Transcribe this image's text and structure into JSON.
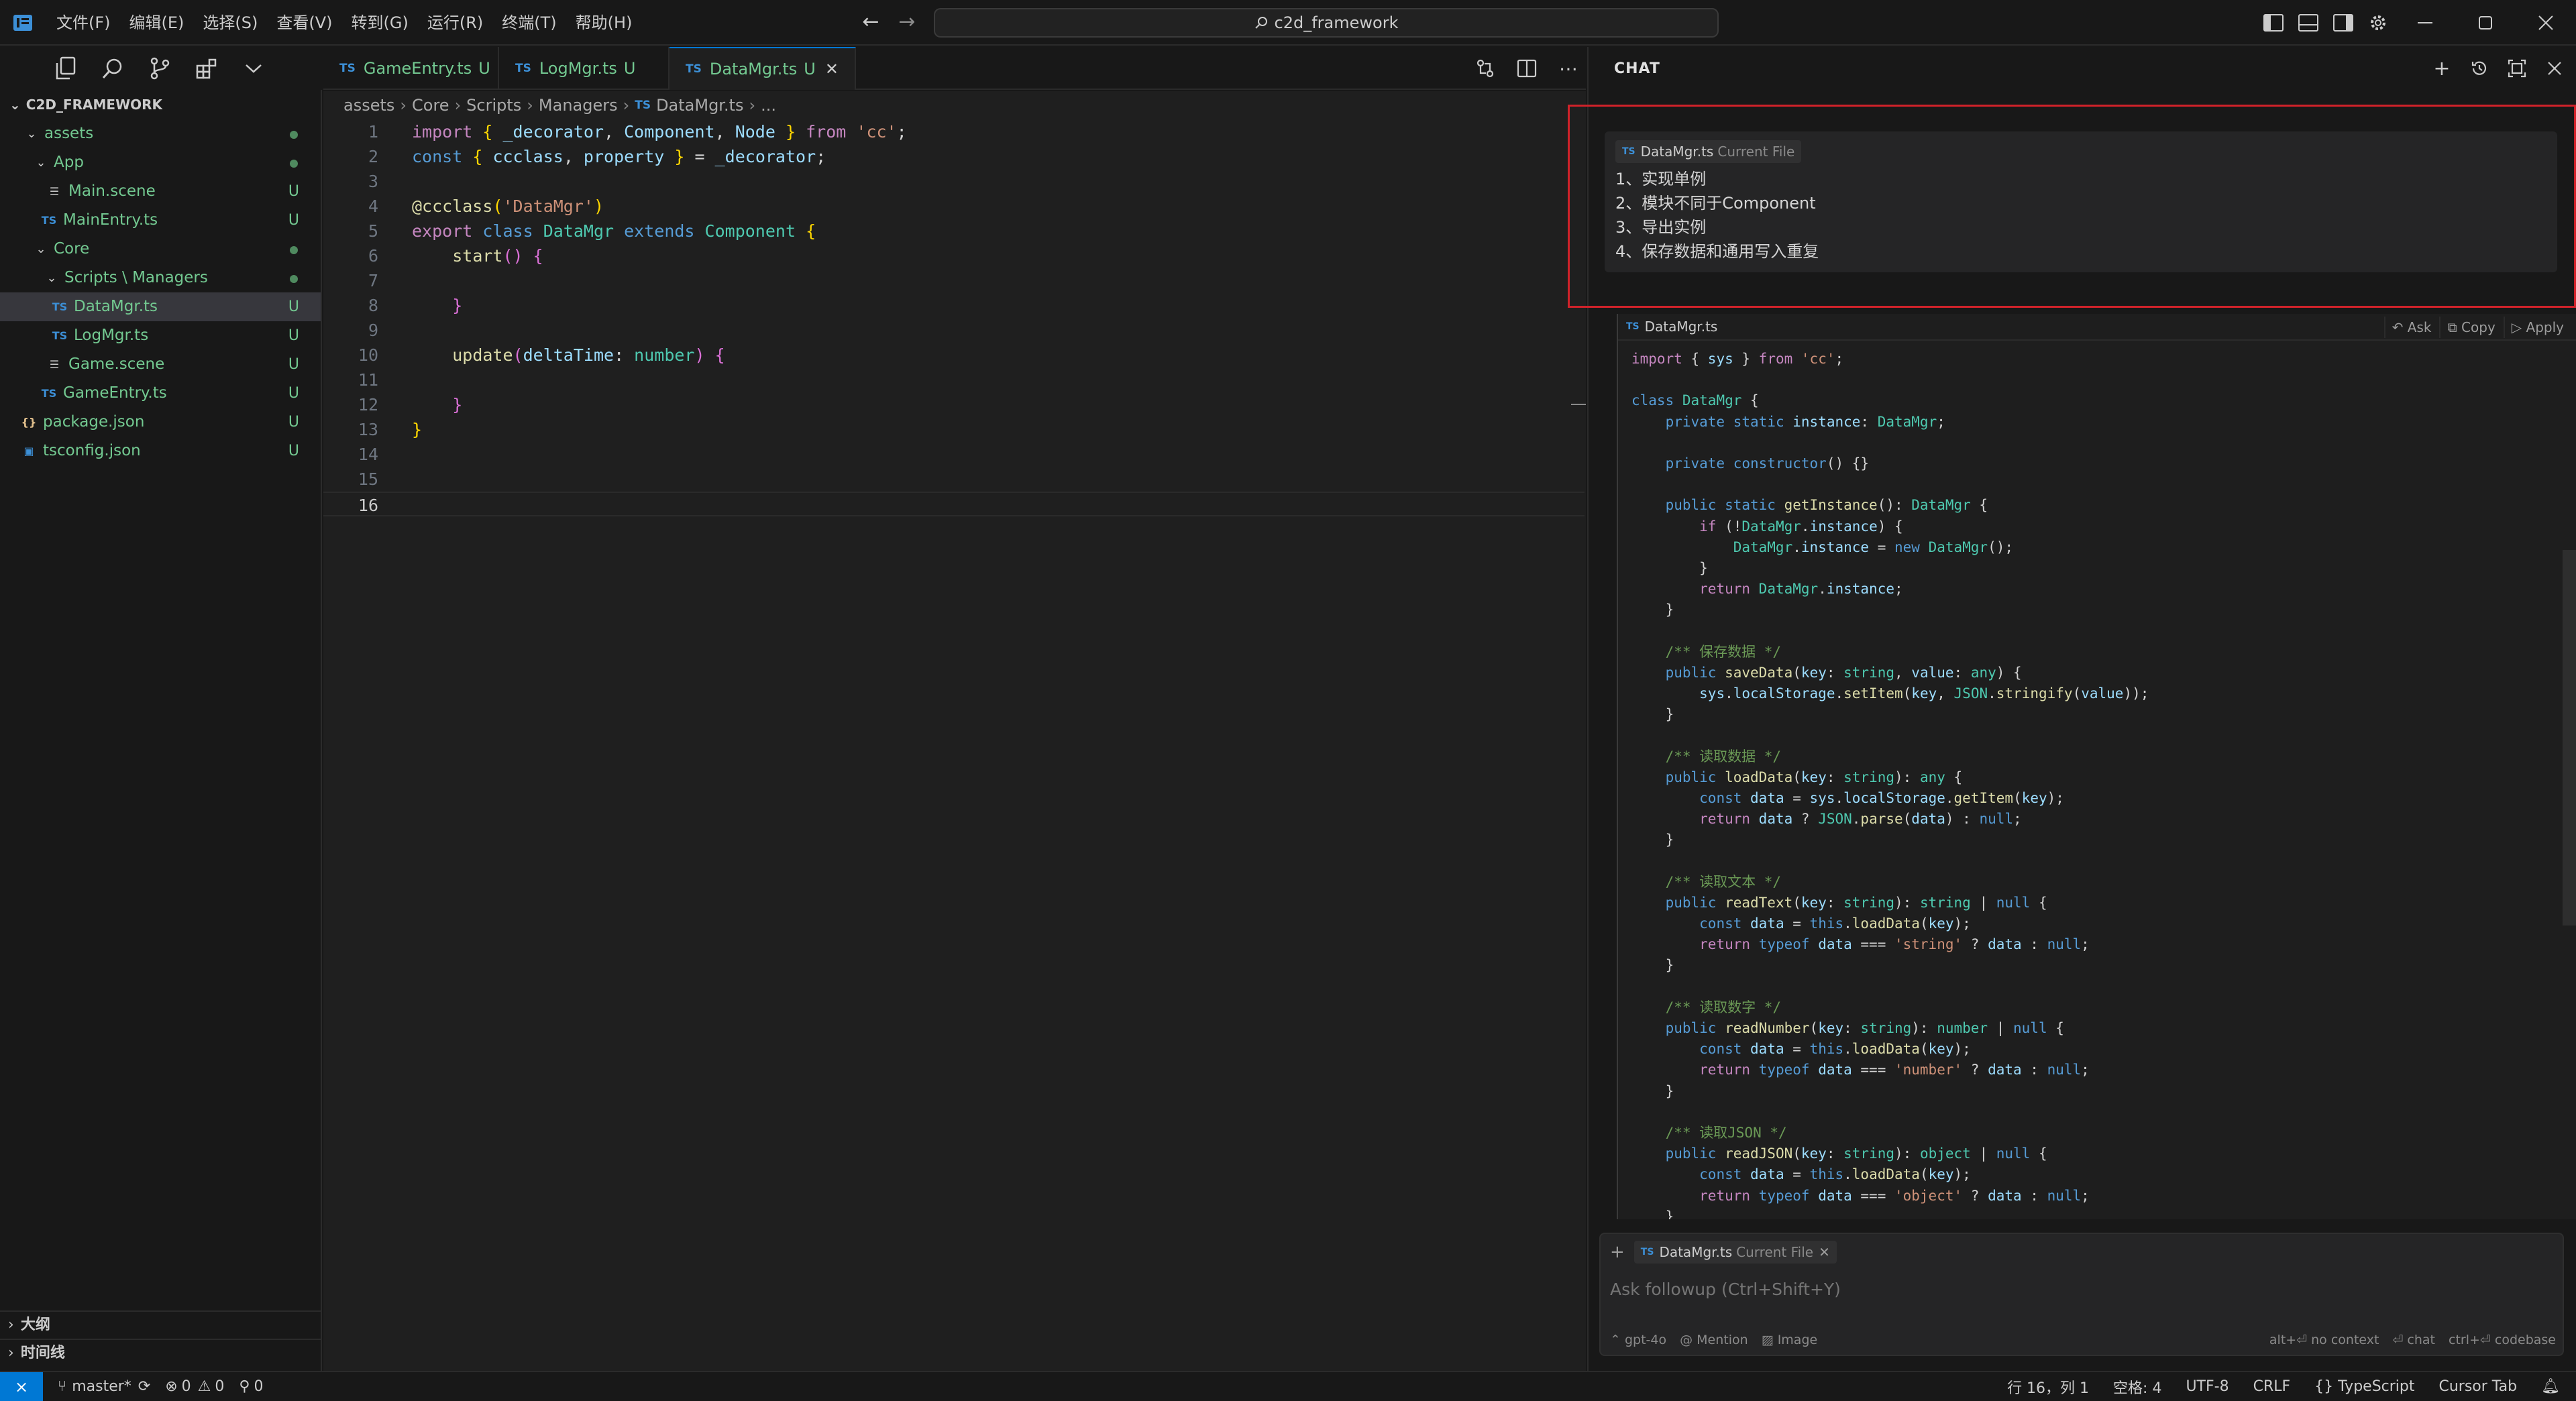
{
  "menubar": [
    "文件(F)",
    "编辑(E)",
    "选择(S)",
    "查看(V)",
    "转到(G)",
    "运行(R)",
    "终端(T)",
    "帮助(H)"
  ],
  "command_center": "c2d_framework",
  "explorer": {
    "root": "C2D_FRAMEWORK",
    "items": [
      {
        "label": "assets",
        "status": ""
      },
      {
        "label": "App",
        "status": ""
      },
      {
        "label": "Main.scene",
        "status": "U"
      },
      {
        "label": "MainEntry.ts",
        "status": "U"
      },
      {
        "label": "Core",
        "status": ""
      },
      {
        "label": "Scripts \\ Managers",
        "status": ""
      },
      {
        "label": "DataMgr.ts",
        "status": "U"
      },
      {
        "label": "LogMgr.ts",
        "status": "U"
      },
      {
        "label": "Game.scene",
        "status": "U"
      },
      {
        "label": "GameEntry.ts",
        "status": "U"
      },
      {
        "label": "package.json",
        "status": "U"
      },
      {
        "label": "tsconfig.json",
        "status": "U"
      }
    ],
    "outline": "大纲",
    "timeline": "时间线"
  },
  "tabs": [
    {
      "badge": "TS",
      "label": "GameEntry.ts",
      "status": "U"
    },
    {
      "badge": "TS",
      "label": "LogMgr.ts",
      "status": "U"
    },
    {
      "badge": "TS",
      "label": "DataMgr.ts",
      "status": "U"
    }
  ],
  "breadcrumb": [
    "assets",
    "Core",
    "Scripts",
    "Managers",
    "DataMgr.ts",
    "..."
  ],
  "editor_line_numbers": [
    "1",
    "2",
    "3",
    "4",
    "5",
    "6",
    "7",
    "8",
    "9",
    "10",
    "11",
    "12",
    "13",
    "14",
    "15",
    "16"
  ],
  "chat": {
    "title": "CHAT",
    "context_file": "DataMgr.ts",
    "context_note": "Current File",
    "user_message": [
      "1、实现单例",
      "2、模块不同于Component",
      "3、导出实例",
      "4、保存数据和通用写入重复"
    ],
    "code_block_file": "DataMgr.ts",
    "code_actions": [
      "Ask",
      "Copy",
      "Apply"
    ],
    "followup_placeholder": "Ask followup (Ctrl+Shift+Y)",
    "followup_chip_file": "DataMgr.ts",
    "followup_chip_note": "Current File",
    "model": "gpt-4o",
    "mention": "Mention",
    "image": "Image",
    "shortcuts": [
      "alt+⏎ no context",
      "⏎ chat",
      "ctrl+⏎ codebase"
    ]
  },
  "statusbar": {
    "branch": "master*",
    "errors": "0",
    "warnings": "0",
    "ports": "0",
    "position": "行 16，列 1",
    "spaces": "空格: 4",
    "encoding": "UTF-8",
    "eol": "CRLF",
    "language": "TypeScript",
    "cursor_tab": "Cursor Tab"
  },
  "colors": {
    "accent": "#0078d4",
    "untracked": "#73c991",
    "highlight_border": "#d0222a"
  }
}
